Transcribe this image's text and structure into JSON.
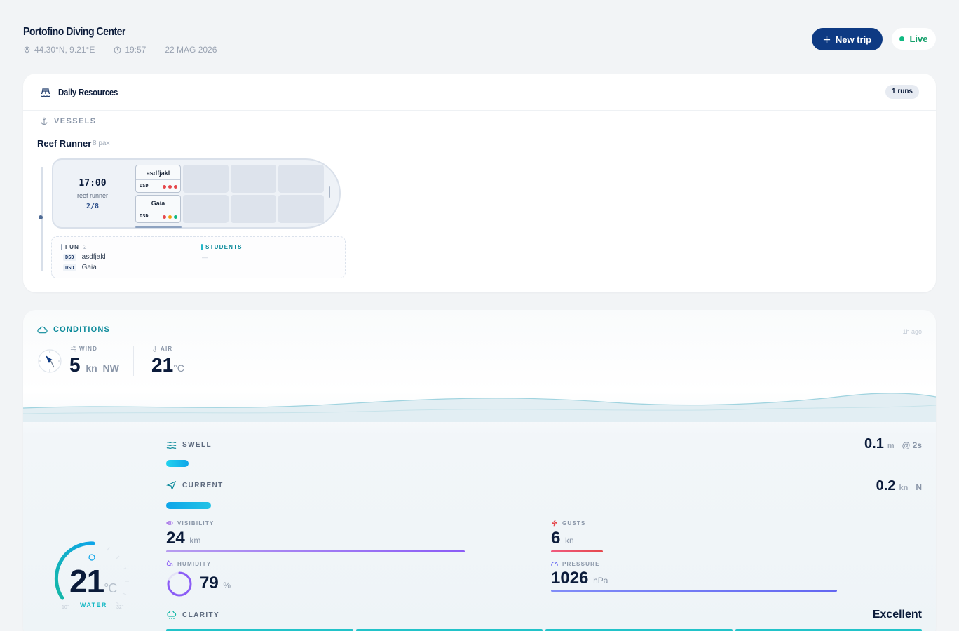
{
  "header": {
    "title": "Portofino Diving Center",
    "coords": "44.30°N, 9.21°E",
    "time": "19:57",
    "date": "22 MAG 2026",
    "new_trip_label": "New trip",
    "live_label": "Live"
  },
  "resources": {
    "title": "Daily Resources",
    "runs_badge": "1 runs",
    "vessels_label": "VESSELS",
    "vessel": {
      "name": "Reef Runner",
      "capacity": "8 pax",
      "trip": {
        "time": "17:00",
        "run_name": "reef runner",
        "occupancy": "2/8",
        "slots": [
          {
            "name": "asdfjakl",
            "tag": "DSD",
            "dots": [
              "#e5484d",
              "#e5484d",
              "#e5484d"
            ]
          },
          {
            "name": "Gaia",
            "tag": "DSD",
            "dots": [
              "#e5484d",
              "#f59e0b",
              "#10b981"
            ]
          }
        ]
      }
    },
    "roster": {
      "fun_label": "FUN",
      "fun_count": "2",
      "students_label": "STUDENTS",
      "students_empty": "—",
      "fun_divers": [
        {
          "tag": "DSD",
          "name": "asdfjakl"
        },
        {
          "tag": "DSD",
          "name": "Gaia"
        }
      ]
    }
  },
  "conditions": {
    "title": "CONDITIONS",
    "updated": "1h ago",
    "wind": {
      "label": "WIND",
      "value": "5",
      "unit": "kn",
      "dir": "NW"
    },
    "air": {
      "label": "AIR",
      "value": "21",
      "unit": "°C"
    },
    "swell": {
      "label": "SWELL",
      "value": "0.1",
      "unit": "m",
      "period": "@ 2s",
      "level": 0.03
    },
    "current": {
      "label": "CURRENT",
      "value": "0.2",
      "unit": "kn",
      "dir": "N",
      "level": 0.06
    },
    "visibility": {
      "label": "VISIBILITY",
      "value": "24",
      "unit": "km",
      "level": 0.8
    },
    "gusts": {
      "label": "GUSTS",
      "value": "6",
      "unit": "kn",
      "level": 0.14
    },
    "humidity": {
      "label": "HUMIDITY",
      "value": "79",
      "unit": "%",
      "level": 0.79
    },
    "pressure": {
      "label": "PRESSURE",
      "value": "1026",
      "unit": "hPa",
      "level": 0.78
    },
    "water": {
      "label": "WATER",
      "value": "21",
      "unit": "°C",
      "min": "10°",
      "max": "32°"
    },
    "clarity": {
      "label": "CLARITY",
      "value": "Excellent",
      "segments": 4
    },
    "colors": {
      "accent": "#0b8a9a",
      "visibility": "#9b5de5",
      "gusts": "#e5484d",
      "pressure": "#6366f1",
      "swell": "#22c3e6",
      "current": "#0ea5e9"
    }
  }
}
